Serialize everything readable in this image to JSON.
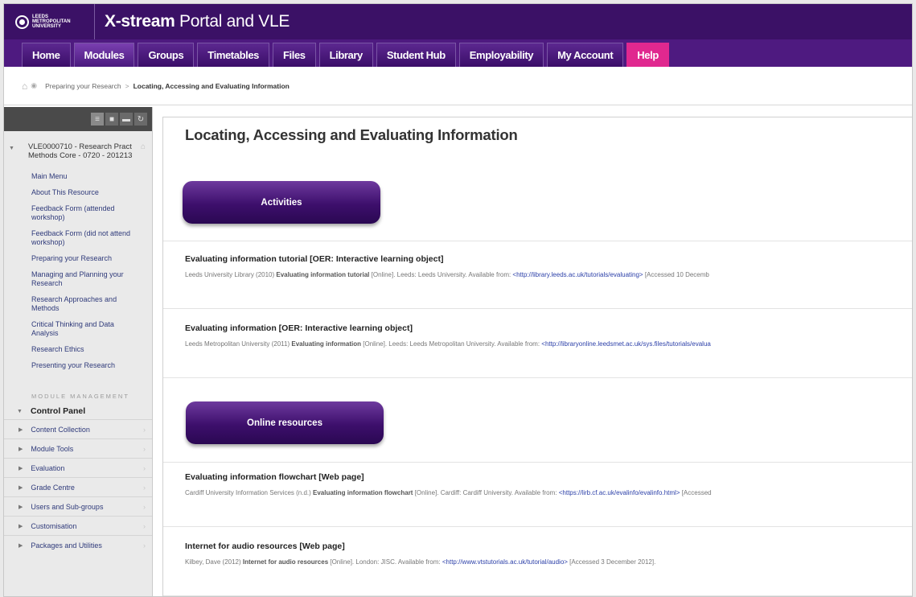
{
  "header": {
    "logo_text": "LEEDS METROPOLITAN UNIVERSITY",
    "portal_bold": "X-stream",
    "portal_rest": " Portal and VLE"
  },
  "tabs": [
    {
      "label": "Home"
    },
    {
      "label": "Modules"
    },
    {
      "label": "Groups"
    },
    {
      "label": "Timetables"
    },
    {
      "label": "Files"
    },
    {
      "label": "Library"
    },
    {
      "label": "Student Hub"
    },
    {
      "label": "Employability"
    },
    {
      "label": "My Account"
    },
    {
      "label": "Help"
    }
  ],
  "breadcrumb": {
    "parent": "Preparing your Research",
    "separator": ">",
    "current": "Locating, Accessing and Evaluating Information"
  },
  "sidebar": {
    "course_title": "VLE0000710 - Research Pract Methods Core - 0720 - 201213",
    "menu": [
      "Main Menu",
      "About This Resource",
      "Feedback Form (attended workshop)",
      "Feedback Form (did not attend workshop)",
      "Preparing your Research",
      "Managing and Planning your Research",
      "Research Approaches and Methods",
      "Critical Thinking and Data Analysis",
      "Research Ethics",
      "Presenting your Research"
    ],
    "management_heading": "MODULE MANAGEMENT",
    "control_panel": "Control Panel",
    "control_items": [
      "Content Collection",
      "Module Tools",
      "Evaluation",
      "Grade Centre",
      "Users and Sub-groups",
      "Customisation",
      "Packages and Utilities"
    ]
  },
  "main": {
    "title": "Locating, Accessing and Evaluating Information",
    "activities_button": "Activities",
    "online_button": "Online resources",
    "entries": [
      {
        "title": "Evaluating information tutorial [OER: Interactive learning object]",
        "pre": "Leeds University Library (2010) ",
        "bold": "Evaluating information tutorial",
        "mid": " [Online]. Leeds: Leeds University. Available from: ",
        "link": "<http://library.leeds.ac.uk/tutorials/evaluating>",
        "post": " [Accessed 10 Decemb"
      },
      {
        "title": "Evaluating information [OER: Interactive learning object]",
        "pre": "Leeds Metropolitan University (2011) ",
        "bold": "Evaluating information",
        "mid": " [Online]. Leeds: Leeds Metropolitan University. Available from: ",
        "link": "<http://libraryonline.leedsmet.ac.uk/sys.files/tutorials/evalua",
        "post": ""
      },
      {
        "title": "Evaluating information flowchart [Web page]",
        "pre": "Cardiff University Information Services (n.d.) ",
        "bold": "Evaluating information flowchart",
        "mid": " [Online]. Cardiff: Cardiff University. Available from: ",
        "link": "<https://lirb.cf.ac.uk/evalinfo/evalinfo.html>",
        "post": " [Accessed"
      },
      {
        "title": "Internet for audio resources [Web page]",
        "pre": "Kilbey, Dave (2012) ",
        "bold": "Internet for audio resources",
        "mid": " [Online]. London: JISC. Available from: ",
        "link": "<http://www.vtstutorials.ac.uk/tutorial/audio>",
        "post": " [Accessed 3 December 2012]."
      }
    ]
  },
  "colors": {
    "header_bg": "#3b1166",
    "tab_bar": "#4e1a80",
    "help_tab": "#e0288f",
    "button_purple": "#3d0f6c"
  }
}
